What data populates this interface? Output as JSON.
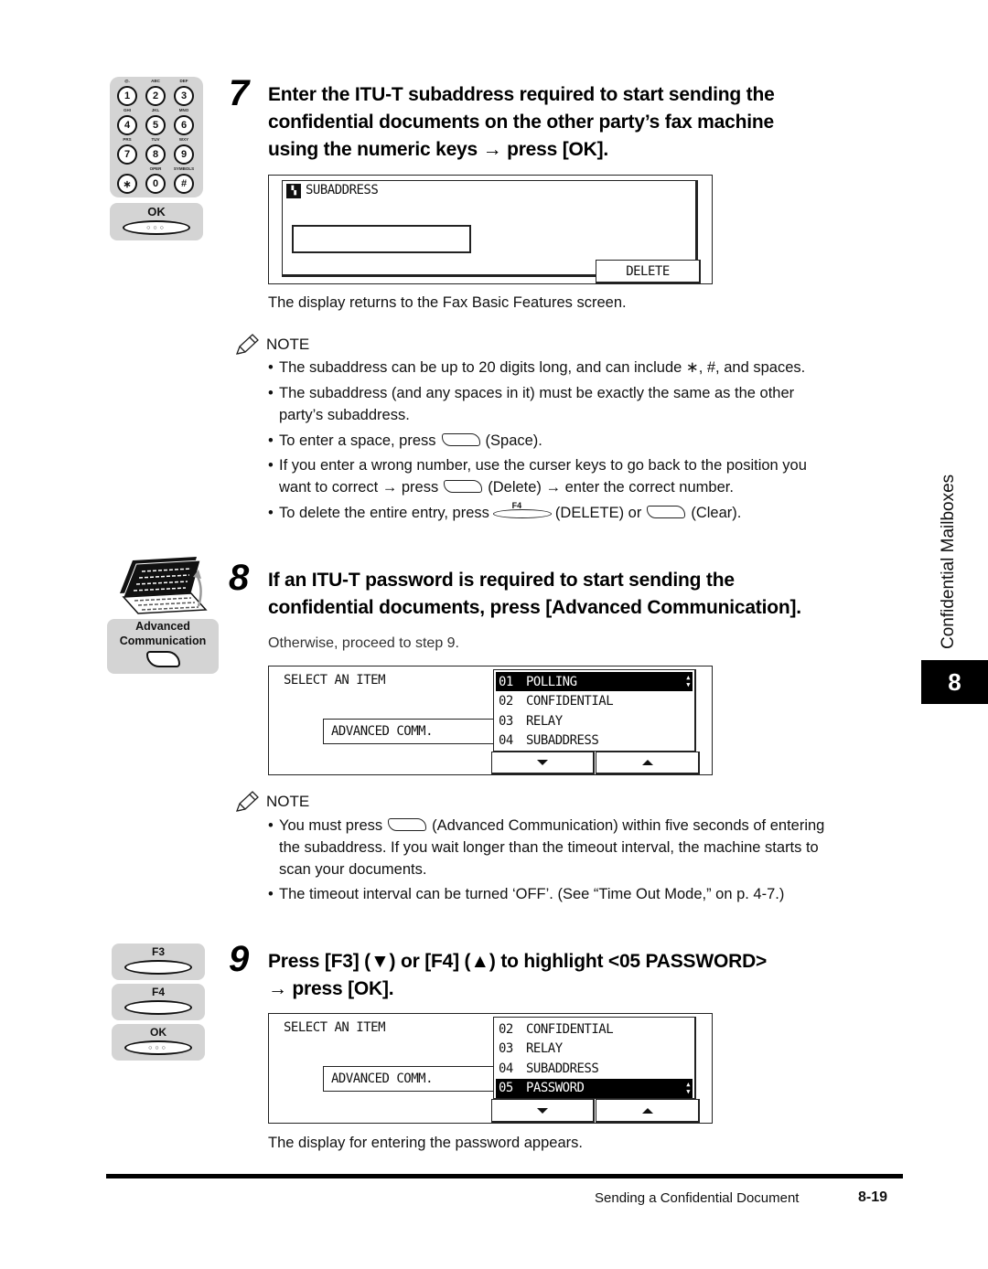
{
  "side_tab": {
    "section_label": "Confidential Mailboxes",
    "chapter_number": "8"
  },
  "keypad": {
    "keys": [
      {
        "digit": "1",
        "sub": "@."
      },
      {
        "digit": "2",
        "sub": "ABC"
      },
      {
        "digit": "3",
        "sub": "DEF"
      },
      {
        "digit": "4",
        "sub": "GHI"
      },
      {
        "digit": "5",
        "sub": "JKL"
      },
      {
        "digit": "6",
        "sub": "MNO"
      },
      {
        "digit": "7",
        "sub": "PRS"
      },
      {
        "digit": "8",
        "sub": "TUV"
      },
      {
        "digit": "9",
        "sub": "WXY"
      },
      {
        "digit": "∗",
        "sub": ""
      },
      {
        "digit": "0",
        "sub": "OPER"
      },
      {
        "digit": "#",
        "sub": "SYMBOLS"
      }
    ],
    "ok_label": "OK",
    "ok_dots": "○○○"
  },
  "adv_comm_key": {
    "label_line1": "Advanced",
    "label_line2": "Communication"
  },
  "fkeys": {
    "f3_label": "F3",
    "f4_label": "F4",
    "ok_label": "OK",
    "ok_dots": "○○○"
  },
  "step7": {
    "number": "7",
    "title_line1": "Enter the ITU-T subaddress required to start sending the",
    "title_line2": "confidential documents on the other party’s fax machine",
    "title_line3": "using the numeric keys → press [OK].",
    "display": {
      "title": "SUBADDRESS",
      "field_value": "",
      "delete_button": "DELETE"
    },
    "result_text": "The display returns to the Fax Basic Features screen.",
    "note": {
      "heading": "NOTE",
      "items": [
        {
          "text": "The subaddress can be up to 20 digits long, and can include ∗, #, and spaces."
        },
        {
          "line1": "The subaddress (and any spaces in it) must be exactly the same as the other",
          "line2": "party’s subaddress."
        },
        {
          "before": "To enter a space, press",
          "after": "(Space)."
        },
        {
          "line1": "If you enter a wrong number, use the curser keys to go back to the position you",
          "before": "want to correct → press",
          "after": "(Delete) → enter the correct number."
        },
        {
          "before": "To delete the entire entry, press",
          "key_label": "F4",
          "middle": "(DELETE) or",
          "after": "(Clear)."
        }
      ]
    }
  },
  "step8": {
    "number": "8",
    "title_line1": "If an ITU-T password is required to start sending the",
    "title_line2": "confidential documents, press [Advanced Communication].",
    "subtext": "Otherwise, proceed to step 9.",
    "display": {
      "title": "SELECT AN ITEM",
      "field_value": "ADVANCED COMM.",
      "list": [
        {
          "num": "01",
          "label": "POLLING",
          "selected": true
        },
        {
          "num": "02",
          "label": "CONFIDENTIAL",
          "selected": false
        },
        {
          "num": "03",
          "label": "RELAY",
          "selected": false
        },
        {
          "num": "04",
          "label": "SUBADDRESS",
          "selected": false
        }
      ]
    },
    "note": {
      "heading": "NOTE",
      "items": [
        {
          "before": "You must press",
          "after": "(Advanced Communication) within five seconds of entering",
          "line2": "the subaddress. If you wait longer than the timeout interval, the machine starts to",
          "line3": "scan your documents."
        },
        {
          "text": "The timeout interval can be turned ‘OFF’. (See “Time Out Mode,” on p. 4-7.)"
        }
      ]
    }
  },
  "step9": {
    "number": "9",
    "title_line1": "Press [F3] (▼) or [F4] (▲) to highlight <05 PASSWORD>",
    "title_line2": "→ press [OK].",
    "display": {
      "title": "SELECT AN ITEM",
      "field_value": "ADVANCED COMM.",
      "list": [
        {
          "num": "02",
          "label": "CONFIDENTIAL",
          "selected": false
        },
        {
          "num": "03",
          "label": "RELAY",
          "selected": false
        },
        {
          "num": "04",
          "label": "SUBADDRESS",
          "selected": false
        },
        {
          "num": "05",
          "label": "PASSWORD",
          "selected": true
        }
      ]
    },
    "result_text": "The display for entering the password appears."
  },
  "footer": {
    "section_title": "Sending a Confidential Document",
    "page_number": "8-19"
  }
}
